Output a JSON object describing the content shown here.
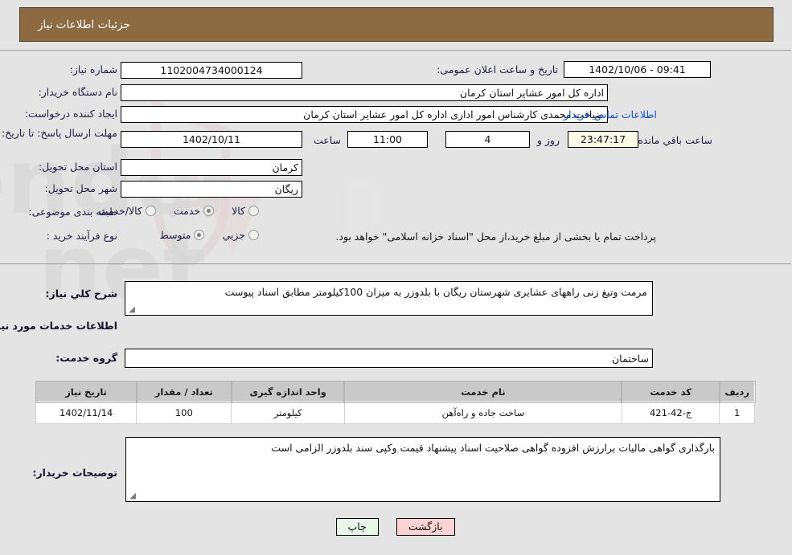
{
  "header": {
    "title": "جزئیات اطلاعات نیاز"
  },
  "form": {
    "need_number_label": "شماره نیاز:",
    "need_number_value": "1102004734000124",
    "public_announce_label": "تاریخ و ساعت اعلان عمومی:",
    "public_announce_value": "1402/10/06 - 09:41",
    "buyer_org_label": "نام دستگاه خریدار:",
    "buyer_org_value": "اداره کل امور عشایر استان کرمان",
    "requester_label": "ایجاد کننده درخواست:",
    "requester_value": "ضیافت محمدی کارشناس امور اداری اداره کل امور عشایر استان کرمان",
    "contact_link": "اطلاعات تماس خریدار",
    "deadline_label": "مهلت ارسال پاسخ: تا تاریخ:",
    "deadline_date": "1402/10/11",
    "hour_label": "ساعت",
    "hour_value": "11:00",
    "days_value": "4",
    "days_label": "روز و",
    "remaining_value": "23:47:17",
    "remaining_label": "ساعت باقي مانده",
    "province_label": "استان محل تحویل:",
    "province_value": "کرمان",
    "city_label": "شهر محل تحویل:",
    "city_value": "ریگان",
    "category_label": "طبقه بندی موضوعی:",
    "category_options": [
      {
        "label": "کالا",
        "selected": false
      },
      {
        "label": "خدمت",
        "selected": true
      },
      {
        "label": "کالا/خدمت",
        "selected": false
      }
    ],
    "purchase_type_label": "نوع فرآیند خرید :",
    "purchase_type_options": [
      {
        "label": "جزیي",
        "selected": false
      },
      {
        "label": "متوسط",
        "selected": true
      }
    ],
    "purchase_note": "پرداخت تمام یا بخشی از مبلغ خرید،از محل \"اسناد خزانه اسلامی\" خواهد بود."
  },
  "need_summary": {
    "label": "شرح کلي نياز:",
    "value": "مرمت وتیغ زنی راههای عشایری شهرستان ریگان با بلدوزر  به میزان 100کیلومتر مطابق اسناد پیوست"
  },
  "services_section": {
    "heading": "اطلاعات خدمات مورد نیاز",
    "service_group_label": "گروه خدمت:",
    "service_group_value": "ساختمان"
  },
  "items_table": {
    "columns": [
      "ردیف",
      "کد خدمت",
      "نام خدمت",
      "واحد اندازه گیری",
      "تعداد / مقدار",
      "تاریخ نیاز"
    ],
    "rows": [
      {
        "row_no": "1",
        "service_code": "ج-42-421",
        "service_name": "ساخت جاده و راه‌آهن",
        "unit": "کیلومتر",
        "quantity": "100",
        "need_date": "1402/11/14"
      }
    ]
  },
  "buyer_notes": {
    "label": "توضیحات خریدار:",
    "value": "بارگذاری گواهی مالیات برارزش افزوده گواهی صلاحیت اسناد پیشنهاد قیمت وکپی سند بلدوزر الزامی است"
  },
  "footer": {
    "print_label": "چاپ",
    "back_label": "بازگشت"
  },
  "watermark": {
    "text": "AriaTender.net"
  },
  "colors": {
    "header_bg": "#8d6b42",
    "page_bg": "#e4e4e4",
    "label_text": "#1d1d47",
    "link": "#0b4fd6",
    "print_btn": "#e9f7e9",
    "back_btn": "#fbd3d3",
    "highlight_field": "#fbfbe7",
    "table_header": "#c9c9c9"
  }
}
